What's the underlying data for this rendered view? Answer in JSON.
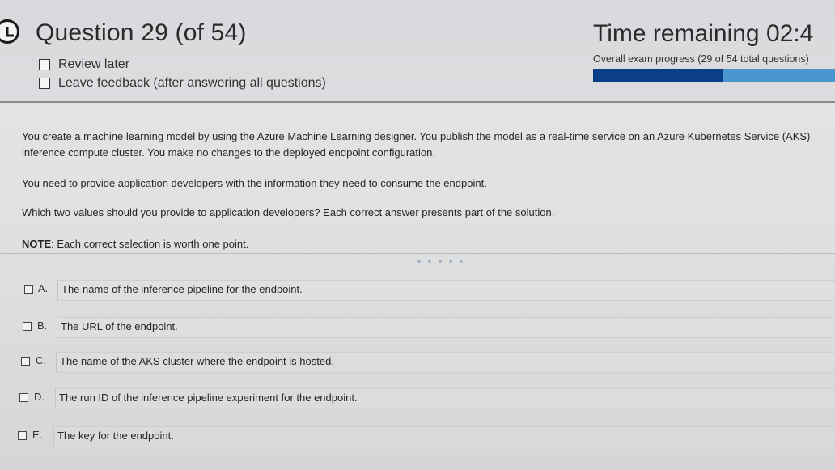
{
  "header": {
    "question_title": "Question 29 (of 54)",
    "review_later_label": "Review later",
    "leave_feedback_label": "Leave feedback (after answering all questions)",
    "time_remaining": "Time remaining  02:4",
    "progress_label": "Overall exam progress (29 of 54 total questions)",
    "progress_fraction": 0.537
  },
  "question": {
    "paragraph1": "You create a machine learning model by using the Azure Machine Learning designer. You publish the model as a real-time service on an Azure Kubernetes Service (AKS) inference compute cluster. You make no changes to the deployed endpoint configuration.",
    "paragraph2": "You need to provide application developers with the information they need to consume the endpoint.",
    "paragraph3": "Which two values should you provide to application developers? Each correct answer presents part of the solution.",
    "note_prefix": "NOTE",
    "note_text": ": Each correct selection is worth one point."
  },
  "options": [
    {
      "letter": "A.",
      "text": "The name of the inference pipeline for the endpoint."
    },
    {
      "letter": "B.",
      "text": "The URL of the endpoint."
    },
    {
      "letter": "C.",
      "text": "The name of the AKS cluster where the endpoint is hosted."
    },
    {
      "letter": "D.",
      "text": "The run ID of the inference pipeline experiment for the endpoint."
    },
    {
      "letter": "E.",
      "text": "The key for the endpoint."
    }
  ],
  "colors": {
    "progress_done": "#0a3f88",
    "progress_remaining": "#4c96cf"
  },
  "icons": {
    "back": "back-arrow-circle-icon",
    "loading": "loading-dots-icon"
  }
}
